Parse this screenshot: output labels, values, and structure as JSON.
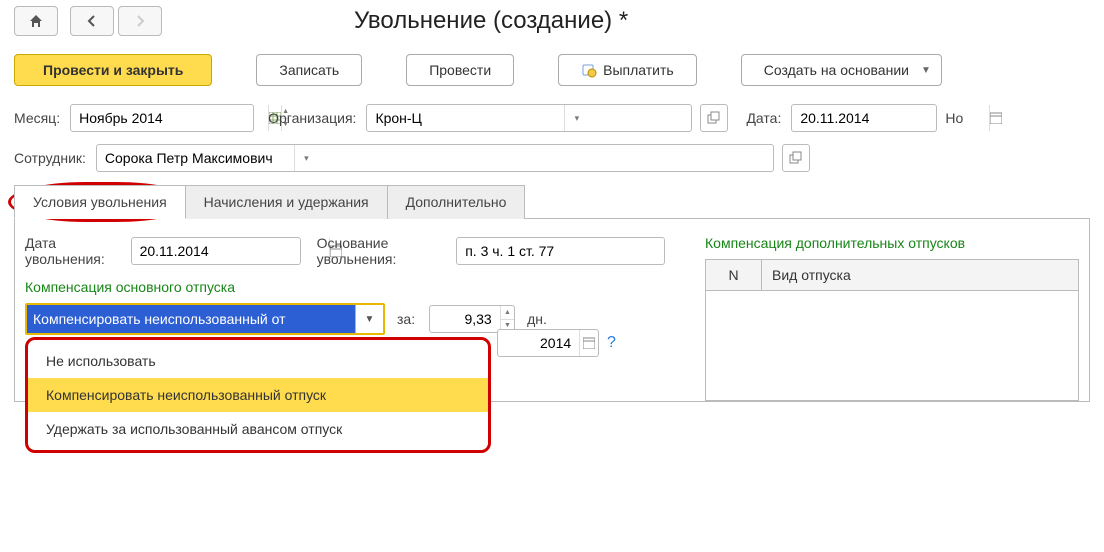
{
  "title": "Увольнение (создание) *",
  "toolbar": {
    "primary": "Провести и закрыть",
    "save": "Записать",
    "post": "Провести",
    "pay": "Выплатить",
    "create_based": "Создать на основании"
  },
  "row1": {
    "month_label": "Месяц:",
    "month_value": "Ноябрь 2014",
    "org_label": "Организация:",
    "org_value": "Крон-Ц",
    "date_label": "Дата:",
    "date_value": "20.11.2014",
    "num_label_cut": "Но"
  },
  "row2": {
    "emp_label": "Сотрудник:",
    "emp_value": "Сорока Петр Максимович"
  },
  "tabs": {
    "t1": "Условия увольнения",
    "t2": "Начисления и удержания",
    "t3": "Дополнительно"
  },
  "dismiss": {
    "date_label": "Дата увольнения:",
    "date_value": "20.11.2014",
    "reason_label": "Основание увольнения:",
    "reason_value": "п. 3 ч. 1 ст. 77"
  },
  "comp_main": {
    "title": "Компенсация основного отпуска",
    "selected_cut": "Компенсировать неиспользованный от",
    "for_label": "за:",
    "days_value": "9,33",
    "days_unit": "дн.",
    "opt1": "Не использовать",
    "opt2": "Компенсировать неиспользованный отпуск",
    "opt3": "Удержать за использованный авансом отпуск",
    "behind_year": "2014"
  },
  "comp_extra": {
    "title": "Компенсация дополнительных отпусков",
    "col_n": "N",
    "col_kind": "Вид отпуска"
  }
}
